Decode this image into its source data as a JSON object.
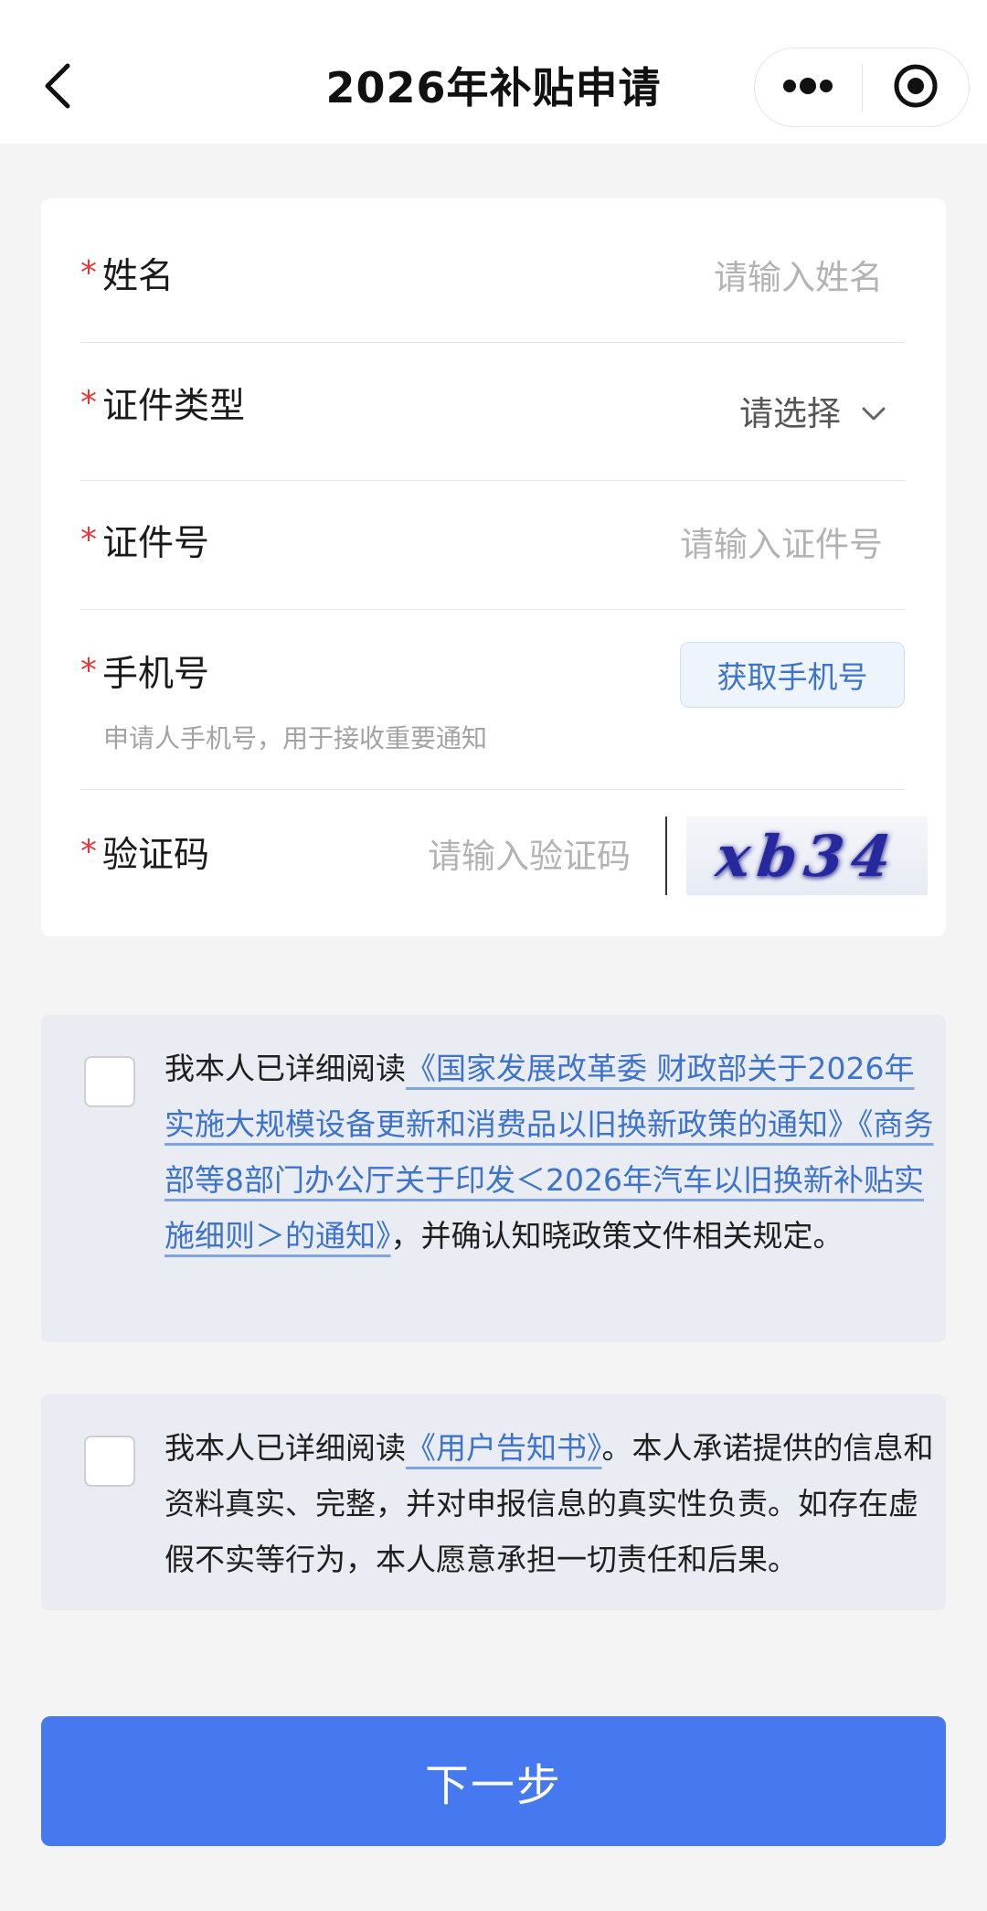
{
  "nav": {
    "title": "2026年补贴申请",
    "back_icon": "chevron-left-icon",
    "more_icon": "more-dots-icon",
    "close_icon": "target-circle-icon"
  },
  "form": {
    "required_mark": "*",
    "name": {
      "label": "姓名",
      "placeholder": "请输入姓名"
    },
    "id_type": {
      "label": "证件类型",
      "value": "请选择",
      "icon": "chevron-down-icon"
    },
    "id_number": {
      "label": "证件号",
      "placeholder": "请输入证件号"
    },
    "phone": {
      "label": "手机号",
      "button": "获取手机号",
      "hint": "申请人手机号，用于接收重要通知"
    },
    "captcha": {
      "label": "验证码",
      "placeholder": "请输入验证码",
      "image_text": "xb34"
    }
  },
  "agreement1": {
    "prefix": "我本人已详细阅读",
    "link1": "《国家发展改革委 财政部关于2026年实施大规模设备更新和消费品以旧换新政策的通知》",
    "link2": "《商务部等8部门办公厅关于印发＜2026年汽车以旧换新补贴实施细则＞的通知》",
    "suffix": "，并确认知晓政策文件相关规定。"
  },
  "agreement2": {
    "prefix": "我本人已详细阅读",
    "link": "《用户告知书》",
    "suffix": "。本人承诺提供的信息和资料真实、完整，并对申报信息的真实性负责。如存在虚假不实等行为，本人愿意承担一切责任和后果。"
  },
  "next_button": "下一步",
  "colors": {
    "accent": "#4678f0",
    "link": "#3d73cc",
    "required": "#e4393c",
    "page_bg": "#f4f4f5",
    "agreement_bg": "#e9ecf2"
  }
}
